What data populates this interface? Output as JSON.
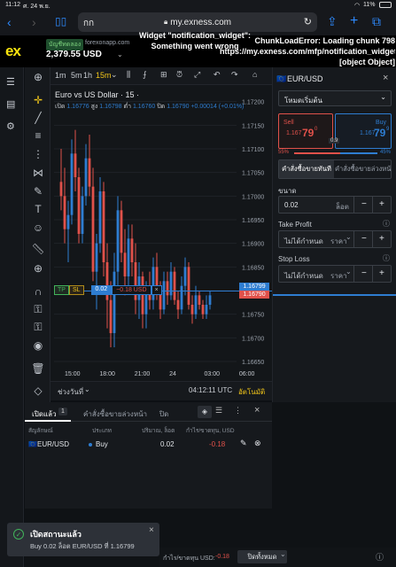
{
  "statusbar": {
    "time": "11:12",
    "date": "ศ. 24 พ.ย.",
    "battery": "11%"
  },
  "safari": {
    "aa_label": "กก",
    "url": "my.exness.com"
  },
  "header": {
    "badge": "บัญชีทดลอง",
    "domain": "forexonapp.com",
    "balance": "2,379.55 USD",
    "widget_error": "Widget \"notification_widget\": Something went wrong",
    "chunk_error": "ChunkLoadError: Loading chunk 798 https://my.exness.com/mfp/notification_widget [object Object]"
  },
  "chart_toolbar": {
    "timeframes": [
      "1m",
      "5m",
      "1h",
      "15m"
    ],
    "active_timeframe": "15m"
  },
  "chart": {
    "symbol_title": "Euro vs US Dollar · 15 ·",
    "ohlc": {
      "o_label": "เปิด",
      "o": "1.16776",
      "h_label": "สูง",
      "h": "1.16798",
      "l_label": "ต่ำ",
      "l": "1.16760",
      "c_label": "ปิด",
      "c": "1.16790",
      "chg": "+0.00014 (+0.01%)"
    },
    "price_badge_ask": "1.16799",
    "price_badge_bid": "1.16790",
    "position_line": {
      "tp": "TP",
      "sl": "SL",
      "lot": "0.02",
      "pnl": "−0.18 USD"
    },
    "bottom_range_label": "ช่วงวันที่",
    "clock": "04:12:11 UTC",
    "auto_label": "อัตโนมัติ"
  },
  "chart_data": {
    "type": "candlestick",
    "y_ticks": [
      "1.17200",
      "1.17150",
      "1.17100",
      "1.17050",
      "1.17000",
      "1.16950",
      "1.16900",
      "1.16850",
      "1.16800",
      "1.16750",
      "1.16700",
      "1.16650"
    ],
    "x_ticks": [
      "15:00",
      "18:00",
      "21:00",
      "24",
      "03:00",
      "06:00"
    ],
    "ylim": [
      1.1665,
      1.1722
    ],
    "candles": [
      [
        1.1703,
        1.171,
        1.1697,
        1.17
      ],
      [
        1.17,
        1.1706,
        1.169,
        1.1693
      ],
      [
        1.1693,
        1.1699,
        1.1686,
        1.1696
      ],
      [
        1.1696,
        1.1712,
        1.1694,
        1.1709
      ],
      [
        1.1709,
        1.1714,
        1.1701,
        1.1704
      ],
      [
        1.1704,
        1.1706,
        1.169,
        1.1692
      ],
      [
        1.1692,
        1.1702,
        1.169,
        1.17
      ],
      [
        1.17,
        1.1711,
        1.1698,
        1.1708
      ],
      [
        1.1708,
        1.1713,
        1.17,
        1.1702
      ],
      [
        1.1702,
        1.1706,
        1.1682,
        1.1684
      ],
      [
        1.1684,
        1.1692,
        1.1676,
        1.169
      ],
      [
        1.169,
        1.1704,
        1.1688,
        1.1701
      ],
      [
        1.1701,
        1.1703,
        1.1683,
        1.1686
      ],
      [
        1.1686,
        1.169,
        1.1672,
        1.1678
      ],
      [
        1.1678,
        1.1682,
        1.1668,
        1.1671
      ],
      [
        1.1671,
        1.1688,
        1.1668,
        1.1684
      ],
      [
        1.1684,
        1.17,
        1.1681,
        1.1697
      ],
      [
        1.1697,
        1.1699,
        1.1686,
        1.1688
      ],
      [
        1.1688,
        1.1693,
        1.1679,
        1.1683
      ],
      [
        1.1683,
        1.1694,
        1.168,
        1.1691
      ],
      [
        1.1691,
        1.1694,
        1.1683,
        1.1686
      ],
      [
        1.1686,
        1.169,
        1.1675,
        1.1678
      ],
      [
        1.1678,
        1.1686,
        1.1674,
        1.1683
      ],
      [
        1.1683,
        1.1684,
        1.1672,
        1.1675
      ],
      [
        1.1675,
        1.1682,
        1.1672,
        1.168
      ],
      [
        1.168,
        1.1684,
        1.1676,
        1.1678
      ],
      [
        1.1678,
        1.1687,
        1.1676,
        1.1685
      ],
      [
        1.1685,
        1.1688,
        1.1678,
        1.168
      ],
      [
        1.168,
        1.1682,
        1.1674,
        1.1676
      ],
      [
        1.1676,
        1.1684,
        1.1675,
        1.1682
      ],
      [
        1.1682,
        1.1684,
        1.1677,
        1.1679
      ],
      [
        1.1679,
        1.1686,
        1.1678,
        1.1684
      ],
      [
        1.1684,
        1.1685,
        1.1677,
        1.1678
      ],
      [
        1.1678,
        1.168,
        1.1674,
        1.1676
      ],
      [
        1.1676,
        1.1683,
        1.1675,
        1.1681
      ],
      [
        1.1681,
        1.1687,
        1.1679,
        1.1685
      ],
      [
        1.1685,
        1.1686,
        1.1676,
        1.1677
      ],
      [
        1.1677,
        1.1679,
        1.1673,
        1.1675
      ],
      [
        1.1675,
        1.1681,
        1.1674,
        1.1679
      ],
      [
        1.1679,
        1.168,
        1.1676,
        1.1677
      ],
      [
        1.1677,
        1.1678,
        1.1674,
        1.1675
      ],
      [
        1.1675,
        1.1679,
        1.1674,
        1.1677
      ],
      [
        1.1677,
        1.168,
        1.1676,
        1.1679
      ]
    ],
    "up_color": "#2e7dd1",
    "down_color": "#e0514a"
  },
  "order_panel": {
    "symbol": "EUR/USD",
    "mode": "โหมดเริ่มต้น",
    "sell_label": "Sell",
    "sell_price_main": "1.167",
    "sell_price_big": "79",
    "sell_price_sup": "0",
    "buy_label": "Buy",
    "buy_price_main": "1.167",
    "buy_price_big": "79",
    "buy_price_sup": "9",
    "spread": "0.9",
    "sell_pct": "55%",
    "buy_pct": "45%",
    "tab_market": "คำสั่งซื้อขายทันที",
    "tab_pending": "คำสั่งซื้อขายล่วงหน้า",
    "volume_label": "ขนาด",
    "volume_value": "0.02",
    "volume_unit": "ล็อต",
    "tp_label": "Take Profit",
    "tp_value": "ไม่ได้กำหนด",
    "tp_unit": "ราคา",
    "sl_label": "Stop Loss",
    "sl_value": "ไม่ได้กำหนด",
    "sl_unit": "ราคา"
  },
  "positions": {
    "tab_open": "เปิดแล้ว",
    "tab_open_count": "1",
    "tab_pending": "คำสั่งซื้อขายล่วงหน้า",
    "tab_closed": "ปิด",
    "headers": {
      "symbol": "สัญลักษณ์",
      "type": "ประเภท",
      "volume": "ปริมาณ, ล็อต",
      "pnl": "กำไร/ขาดทุน, USD"
    },
    "rows": [
      {
        "symbol": "EUR/USD",
        "type": "Buy",
        "volume": "0.02",
        "pnl": "-0.18"
      }
    ]
  },
  "toast": {
    "title": "เปิดสถานะแล้ว",
    "body": "Buy 0.02 ล็อต EUR/USD ที่ 1.16799"
  },
  "bottom": {
    "pnl_label": "กำไร/ขาดทุน USD:",
    "pnl_value": "-0.18",
    "close_all": "ปิดทั้งหมด"
  },
  "colors": {
    "accent": "#2e7dd1",
    "sell": "#e0514a",
    "buy": "#2e7dd1",
    "logo": "#f7e30f"
  }
}
